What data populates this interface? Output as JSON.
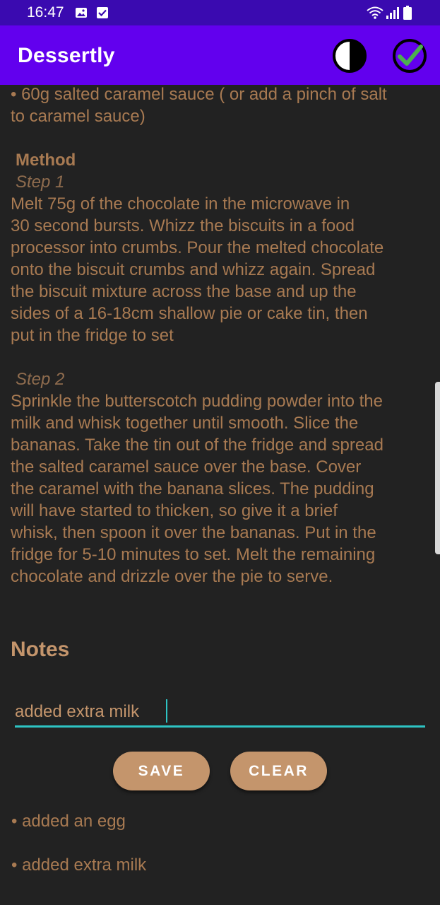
{
  "status_bar": {
    "time": "16:47",
    "icons": [
      "image-icon",
      "check-square-icon",
      "wifi-icon",
      "signal-icon",
      "battery-icon"
    ]
  },
  "app_bar": {
    "title": "Dessertly",
    "actions": [
      "contrast-icon",
      "check-circle-icon"
    ],
    "colors": {
      "bar": "#6200ee",
      "status": "#3a0ab0",
      "check": "#4caf50"
    }
  },
  "recipe": {
    "ingredient_tail": "• 60g salted caramel sauce ( or add a pinch of salt\nto caramel sauce)",
    "method_heading": "Method",
    "steps": [
      {
        "title": "Step 1",
        "text": "Melt 75g of the chocolate in the microwave in\n30 second bursts. Whizz the biscuits in a food\nprocessor into crumbs. Pour the melted chocolate\nonto the biscuit crumbs and whizz again. Spread\nthe biscuit mixture across the base and up the\nsides of a 16-18cm shallow pie or cake tin, then\nput in the fridge to set"
      },
      {
        "title": "Step 2",
        "text": "Sprinkle the butterscotch pudding powder into the\nmilk and whisk together until smooth. Slice the\nbananas. Take the tin out of the fridge and spread\nthe salted caramel sauce over the base. Cover\nthe caramel with the banana slices. The pudding\nwill have started to thicken, so give it a brief\nwhisk, then spoon it over the bananas. Put in the\nfridge for 5-10 minutes to set. Melt the remaining\nchocolate and drizzle over the pie to serve."
      }
    ]
  },
  "notes": {
    "title": "Notes",
    "input_value": "added extra milk",
    "save_label": "SAVE",
    "clear_label": "CLEAR",
    "items": [
      "• added an egg",
      "• added extra milk"
    ],
    "accent": "#c4956c",
    "underline": "#2ec4c4"
  }
}
